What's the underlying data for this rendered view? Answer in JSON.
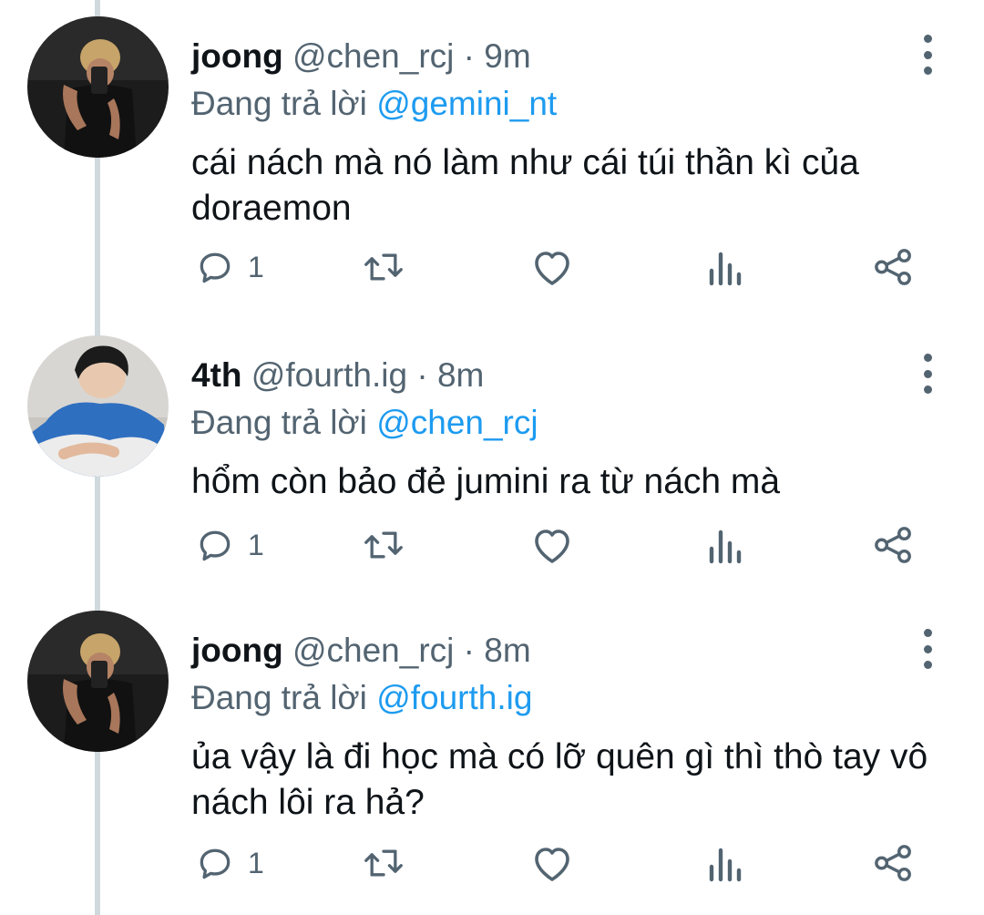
{
  "tweets": [
    {
      "name": "joong",
      "handle": "@chen_rcj",
      "separator": "·",
      "time": "9m",
      "reply_prefix": "Đang trả lời",
      "reply_to": "@gemini_nt",
      "text": "cái nách mà nó làm như cái túi thần kì của doraemon",
      "reply_count": "1",
      "avatar": "avatar-joong"
    },
    {
      "name": "4th",
      "handle": "@fourth.ig",
      "separator": "·",
      "time": "8m",
      "reply_prefix": "Đang trả lời",
      "reply_to": "@chen_rcj",
      "text": "hổm còn bảo đẻ jumini ra từ nách mà",
      "reply_count": "1",
      "avatar": "avatar-4th"
    },
    {
      "name": "joong",
      "handle": "@chen_rcj",
      "separator": "·",
      "time": "8m",
      "reply_prefix": "Đang trả lời",
      "reply_to": "@fourth.ig",
      "text": "ủa vậy là đi học mà có lỡ quên gì thì thò tay vô nách lôi ra hả?",
      "reply_count": "1",
      "avatar": "avatar-joong"
    }
  ],
  "icons": {
    "reply": "reply-icon",
    "retweet": "retweet-icon",
    "like": "heart-icon",
    "views": "views-icon",
    "share": "share-icon",
    "more": "more-vertical-icon"
  },
  "colors": {
    "name": "#0f1419",
    "secondary": "#536471",
    "mention": "#1d9bf0",
    "thread_line": "#cfd9de"
  }
}
